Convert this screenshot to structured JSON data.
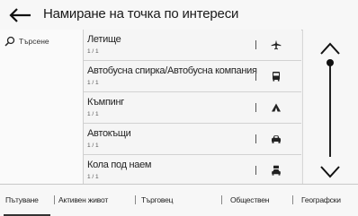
{
  "header": {
    "title": "Намиране на точка по интереси",
    "back_icon": "back-arrow-icon"
  },
  "search": {
    "label": "Търсене",
    "icon": "search-icon"
  },
  "list": {
    "items": [
      {
        "name": "Летище",
        "count": "1 / 1",
        "icon": "airplane-icon"
      },
      {
        "name": "Автобусна спирка/Автобусна компания",
        "count": "1 / 1",
        "icon": "bus-icon"
      },
      {
        "name": "Къмпинг",
        "count": "1 / 1",
        "icon": "tent-icon"
      },
      {
        "name": "Автокъщи",
        "count": "1 / 1",
        "icon": "car-icon"
      },
      {
        "name": "Кола под наем",
        "count": "1 / 1",
        "icon": "car-rental-icon"
      }
    ]
  },
  "scroll": {
    "up_icon": "chevron-up-icon",
    "down_icon": "chevron-down-icon"
  },
  "tabs": [
    {
      "label": "Пътуване",
      "active": true
    },
    {
      "label": "Активен живот"
    },
    {
      "label": "Търговец"
    },
    {
      "label": "Обществен"
    },
    {
      "label": "Географски"
    }
  ],
  "colors": {
    "background": "#f2f2f2",
    "text": "#222222",
    "divider": "#d2d2d2"
  }
}
